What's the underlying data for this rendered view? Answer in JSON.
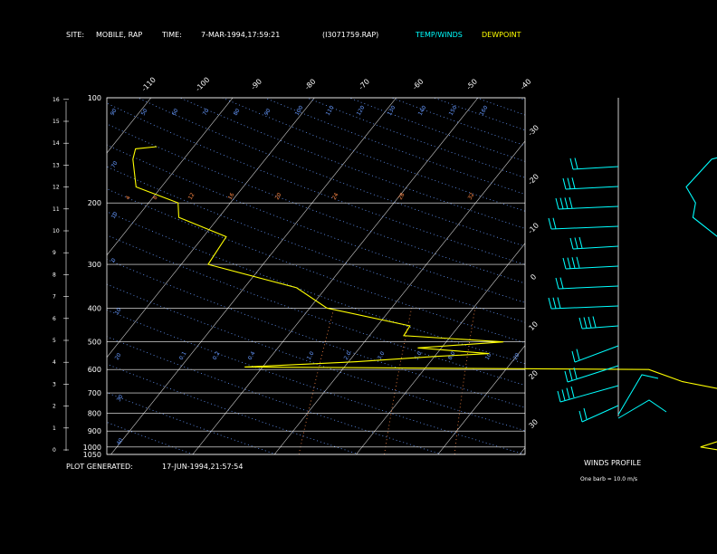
{
  "header": {
    "site_label": "SITE:",
    "site_value": "MOBILE, RAP",
    "time_label": "TIME:",
    "time_value": "7-MAR-1994,17:59:21",
    "file_id": "(I3071759.RAP)",
    "legend_temp": "TEMP/WINDS",
    "legend_dew": "DEWPOINT"
  },
  "footer": {
    "plot_label": "PLOT GENERATED:",
    "plot_value": "17-JUN-1994,21:57:54",
    "winds_title": "WINDS PROFILE",
    "barb_note": "One barb = 10.0 m/s"
  },
  "colors": {
    "temp": "#00ffff",
    "dewpoint": "#ffff00",
    "isotherm": "#ffffff",
    "dry_adiabat": "#6699ff",
    "mixing_ratio": "#ff8844",
    "axis": "#ffffff"
  },
  "chart_data": {
    "type": "line",
    "title": "",
    "pressure_ticks": [
      100,
      200,
      300,
      400,
      500,
      600,
      700,
      800,
      900,
      1000,
      1050
    ],
    "height_ticks": [
      0,
      1,
      2,
      3,
      4,
      5,
      6,
      7,
      8,
      9,
      10,
      11,
      12,
      13,
      14,
      15,
      16
    ],
    "top_temp_ticks": [
      -110,
      -100,
      -90,
      -80,
      -70,
      -60,
      -50,
      -40
    ],
    "right_temp_ticks": [
      -30,
      -20,
      -10,
      0,
      10,
      20,
      30
    ],
    "theta_labels": [
      {
        "v": "90"
      },
      {
        "v": "50"
      },
      {
        "v": "60"
      },
      {
        "v": "70"
      },
      {
        "v": "80"
      },
      {
        "v": "90"
      },
      {
        "v": "100"
      },
      {
        "v": "110"
      },
      {
        "v": "120"
      },
      {
        "v": "130"
      },
      {
        "v": "140"
      },
      {
        "v": "150"
      },
      {
        "v": "160"
      },
      {
        "v": "70"
      },
      {
        "v": "10"
      },
      {
        "v": "0"
      },
      {
        "v": "10"
      },
      {
        "v": "20"
      },
      {
        "v": "30"
      },
      {
        "v": "40"
      }
    ],
    "mixing_labels": [
      "4",
      "8",
      "12",
      "16",
      "20",
      "24",
      "28",
      "32",
      "0.1",
      "0.2",
      "0.4",
      "1.0",
      "2.0",
      "3.0",
      "5.0",
      "8.0",
      "10",
      "20"
    ],
    "series": [
      {
        "name": "TEMP/WINDS",
        "points": [
          [
            1030,
            27.6
          ],
          [
            1000,
            27
          ],
          [
            950,
            26.2
          ],
          [
            900,
            28.8
          ],
          [
            850,
            27
          ],
          [
            800,
            30.1
          ],
          [
            750,
            32.4
          ],
          [
            700,
            32.9
          ],
          [
            650,
            32.6
          ],
          [
            600,
            33.3
          ],
          [
            550,
            31.7
          ],
          [
            500,
            30.2
          ],
          [
            450,
            25.6
          ],
          [
            400,
            19.1
          ],
          [
            350,
            15.8
          ],
          [
            300,
            9
          ],
          [
            250,
            2.9
          ],
          [
            220,
            -2
          ],
          [
            200,
            -3.1
          ],
          [
            180,
            -5.8
          ],
          [
            150,
            -5.4
          ],
          [
            130,
            2
          ]
        ]
      },
      {
        "name": "DEWPOINT",
        "points": [
          [
            1030,
            25.2
          ],
          [
            1000,
            21.4
          ],
          [
            950,
            23.6
          ],
          [
            900,
            23.6
          ],
          [
            850,
            21.6
          ],
          [
            800,
            23.2
          ],
          [
            750,
            22.7
          ],
          [
            700,
            21
          ],
          [
            650,
            12.8
          ],
          [
            600,
            7.5
          ],
          [
            590,
            -42.2
          ],
          [
            570,
            -29
          ],
          [
            550,
            -19.8
          ],
          [
            540,
            -13.6
          ],
          [
            520,
            -22.9
          ],
          [
            500,
            -13
          ],
          [
            480,
            -25.8
          ],
          [
            450,
            -26
          ],
          [
            400,
            -37.9
          ],
          [
            350,
            -43.6
          ],
          [
            300,
            -56.7
          ],
          [
            250,
            -57.2
          ],
          [
            220,
            -64.9
          ],
          [
            200,
            -66.4
          ],
          [
            180,
            -73.1
          ],
          [
            150,
            -76.2
          ],
          [
            140,
            -76.9
          ],
          [
            138,
            -74.5
          ]
        ]
      }
    ],
    "winds_profile": {
      "levels": 13
    }
  }
}
